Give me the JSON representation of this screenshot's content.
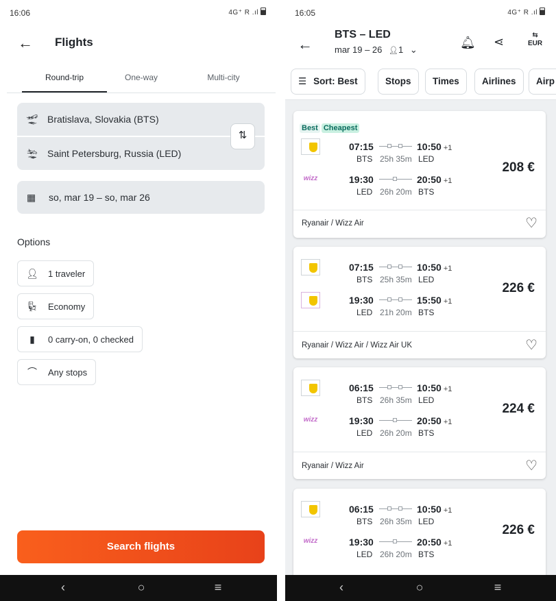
{
  "left": {
    "status": {
      "time": "16:06",
      "icons": "4G⁺ R .ıl"
    },
    "title": "Flights",
    "tabs": [
      "Round-trip",
      "One-way",
      "Multi-city"
    ],
    "origin": "Bratislava, Slovakia (BTS)",
    "destination": "Saint Petersburg, Russia (LED)",
    "dates": "so, mar 19  –  so, mar 26",
    "options_label": "Options",
    "options": [
      "1 traveler",
      "Economy",
      "0 carry-on, 0 checked",
      "Any stops"
    ],
    "search_label": "Search flights"
  },
  "right": {
    "status": {
      "time": "16:05",
      "icons": "4G⁺ R .ıl"
    },
    "route": "BTS – LED",
    "dates": "mar 19 – 26",
    "travelers": "1",
    "currency": "EUR",
    "filters": [
      "Sort: Best",
      "Stops",
      "Times",
      "Airlines",
      "Airp"
    ],
    "results": [
      {
        "badges": [
          "Best",
          "Cheapest"
        ],
        "out": {
          "dep": "07:15",
          "arr": "10:50",
          "plus": "+1",
          "from": "BTS",
          "duration": "25h 35m",
          "to": "LED",
          "airline": "ryanair"
        },
        "ret": {
          "dep": "19:30",
          "arr": "20:50",
          "plus": "+1",
          "from": "LED",
          "duration": "26h 20m",
          "to": "BTS",
          "airline": "wizz"
        },
        "price": "208 €",
        "carriers": "Ryanair / Wizz Air"
      },
      {
        "badges": [],
        "out": {
          "dep": "07:15",
          "arr": "10:50",
          "plus": "+1",
          "from": "BTS",
          "duration": "25h 35m",
          "to": "LED",
          "airline": "ryanair"
        },
        "ret": {
          "dep": "19:30",
          "arr": "15:50",
          "plus": "+1",
          "from": "LED",
          "duration": "21h 20m",
          "to": "BTS",
          "airline": "wizz-uk"
        },
        "price": "226 €",
        "carriers": "Ryanair / Wizz Air / Wizz Air UK"
      },
      {
        "badges": [],
        "out": {
          "dep": "06:15",
          "arr": "10:50",
          "plus": "+1",
          "from": "BTS",
          "duration": "26h 35m",
          "to": "LED",
          "airline": "ryanair"
        },
        "ret": {
          "dep": "19:30",
          "arr": "20:50",
          "plus": "+1",
          "from": "LED",
          "duration": "26h 20m",
          "to": "BTS",
          "airline": "wizz"
        },
        "price": "224 €",
        "carriers": "Ryanair / Wizz Air"
      },
      {
        "badges": [],
        "out": {
          "dep": "06:15",
          "arr": "10:50",
          "plus": "+1",
          "from": "BTS",
          "duration": "26h 35m",
          "to": "LED",
          "airline": "ryanair"
        },
        "ret": {
          "dep": "19:30",
          "arr": "20:50",
          "plus": "+1",
          "from": "LED",
          "duration": "26h 20m",
          "to": "BTS",
          "airline": "wizz"
        },
        "price": "226 €",
        "carriers": ""
      }
    ]
  },
  "colors": {
    "accent": "#f95f1c",
    "accent_dark": "#e8421a",
    "badge_green": "#0b6d5e"
  },
  "icons": {
    "back": "arrow-left-icon",
    "takeoff": "plane-takeoff-icon",
    "landing": "plane-landing-icon",
    "swap": "swap-icon",
    "calendar": "calendar-icon",
    "traveler": "person-icon",
    "cabin": "seat-icon",
    "bag": "luggage-icon",
    "stops": "route-icon",
    "bell": "bell-icon",
    "share": "share-icon",
    "currency": "currency-icon",
    "sort": "sort-icon",
    "heart": "heart-icon"
  }
}
